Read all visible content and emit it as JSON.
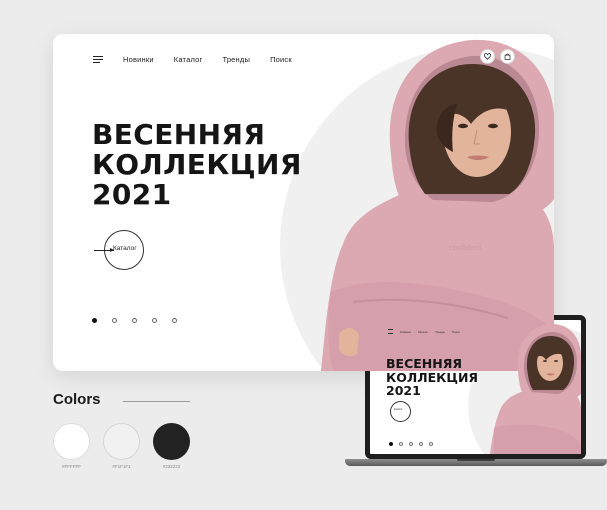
{
  "nav": {
    "items": [
      "Новинки",
      "Каталог",
      "Тренды",
      "Поиск"
    ]
  },
  "hero": {
    "headline_lines": [
      "ВЕСЕННЯЯ",
      "КОЛЛЕКЦИЯ",
      "2021"
    ],
    "catalog_button": "Каталог",
    "slide_count": 5,
    "active_slide": 1
  },
  "header_icons": [
    "heart-icon",
    "shopping-bag-icon"
  ],
  "colors": {
    "title": "Colors",
    "swatches": [
      {
        "hex": "#FFFFFF",
        "label": "#FFFFFF"
      },
      {
        "hex": "#F1F1F1",
        "label": "#F1F1F1"
      },
      {
        "hex": "#222222",
        "label": "#222222"
      }
    ]
  },
  "accent_colors": {
    "hoodie_pink": "#dcaab4",
    "hero_circle": "#f0f0f0",
    "page_background": "#ececec"
  }
}
